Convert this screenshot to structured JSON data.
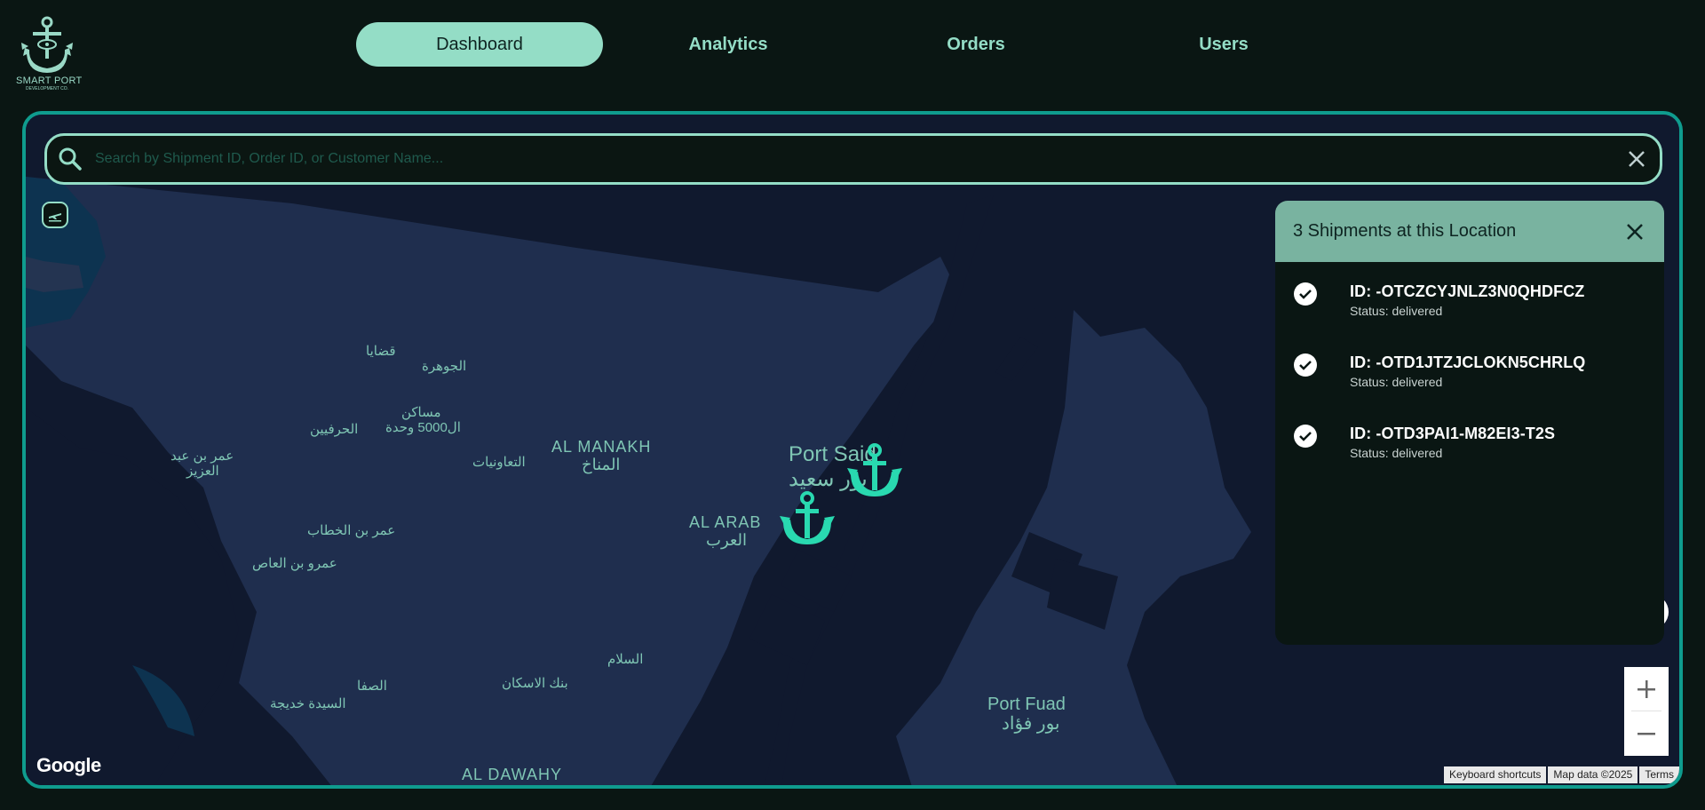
{
  "logo": {
    "title": "SMART PORT",
    "subtitle": "DEVELOPMENT CO."
  },
  "nav": [
    {
      "label": "Dashboard",
      "active": true
    },
    {
      "label": "Analytics",
      "active": false
    },
    {
      "label": "Orders",
      "active": false
    },
    {
      "label": "Users",
      "active": false
    }
  ],
  "search": {
    "placeholder": "Search by Shipment ID, Order ID, or Customer Name...",
    "value": ""
  },
  "map": {
    "places": {
      "qadaya": "قضايا",
      "gawhara": "الجوهرة",
      "masaken": "مساكن",
      "wahda": "ال5000 وحدة",
      "herafiyin": "الحرفيين",
      "omar_abdelaziz": "عمر بن عبد",
      "omar_abdelaziz2": "العزيز",
      "taawoniat": "التعاونيات",
      "manakh_en": "AL MANAKH",
      "manakh_ar": "المناخ",
      "port_said_en": "Port Said",
      "port_said_ar": "بور سعيد",
      "arab_en": "AL ARAB",
      "arab_ar": "العرب",
      "omar_khattab": "عمر بن الخطاب",
      "amr_aas": "عمرو بن العاص",
      "salam": "السلام",
      "bank_eskan": "بنك الاسكان",
      "safa": "الصفا",
      "khadiga": "السيدة خديجة",
      "dawahy": "AL DAWAHY",
      "port_fuad_en": "Port Fuad",
      "port_fuad_ar": "بور فؤاد"
    },
    "markers": [
      "anchor-marker",
      "anchor-marker"
    ],
    "google_label": "Google",
    "attribution": [
      "Keyboard shortcuts",
      "Map data ©2025",
      "Terms"
    ]
  },
  "panel": {
    "title": "3 Shipments at this Location",
    "shipments": [
      {
        "id": "ID: -OTCZCYJNLZ3N0QHDFCZ",
        "status": "Status: delivered"
      },
      {
        "id": "ID: -OTD1JTZJCLOKN5CHRLQ",
        "status": "Status: delivered"
      },
      {
        "id": "ID: -OTD3PAI1-M82EI3-T2S",
        "status": "Status: delivered"
      }
    ]
  },
  "colors": {
    "accent": "#94ddc6",
    "frame": "#0f9c8e",
    "marker": "#29d9b0",
    "background": "#0a1613"
  }
}
